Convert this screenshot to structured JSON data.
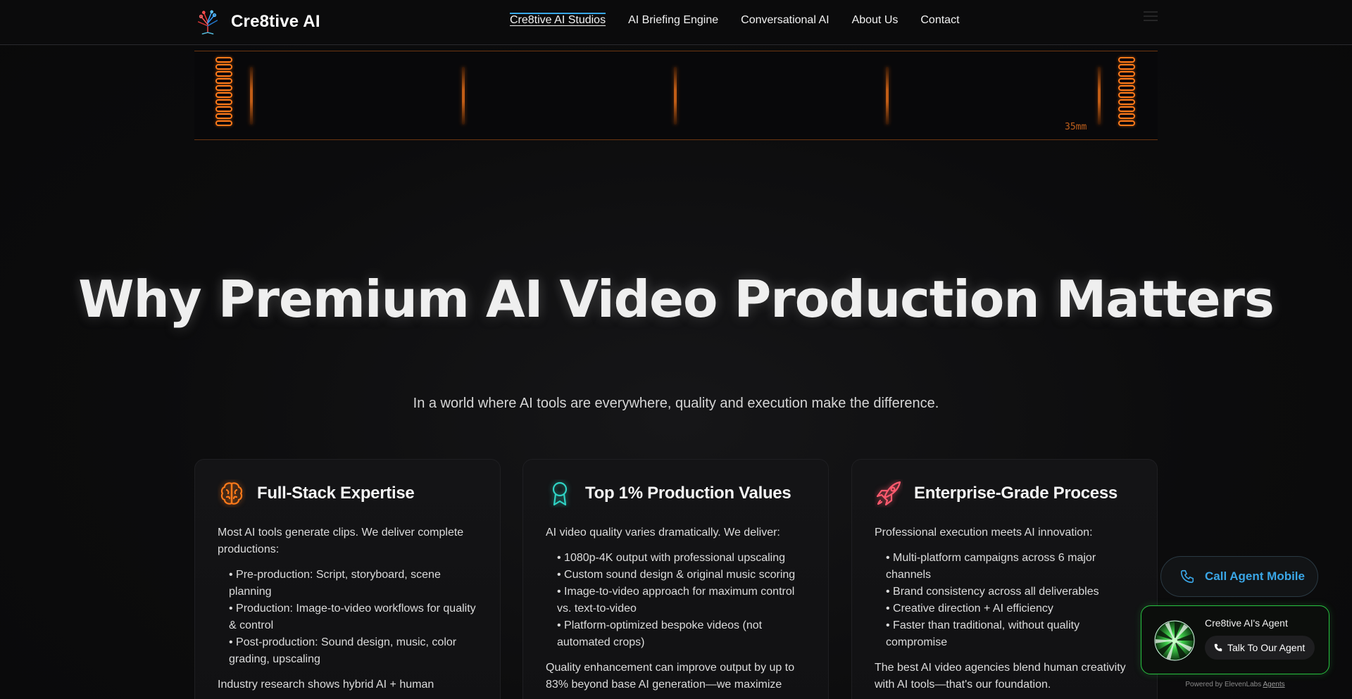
{
  "nav": {
    "brand": "Cre8tive AI",
    "brand_logo_icon": "tree-logo-icon",
    "links": [
      {
        "label": "Cre8tive AI Studios",
        "active": true
      },
      {
        "label": "AI Briefing Engine"
      },
      {
        "label": "Conversational AI"
      },
      {
        "label": "About Us"
      },
      {
        "label": "Contact"
      }
    ],
    "menu_icon": "hamburger-icon"
  },
  "film_strip": {
    "label": "35mm",
    "accent": "#ff7a1a"
  },
  "hero": {
    "title": "Why Premium AI Video Production Matters",
    "subtitle": "In a world where AI tools are everywhere, quality and execution make the difference."
  },
  "cards": [
    {
      "icon": "brain-icon",
      "icon_color": "#ff7a1a",
      "title": "Full-Stack Expertise",
      "intro": "Most AI tools generate clips. We deliver complete productions:",
      "items": [
        "Pre-production: Script, storyboard, scene planning",
        "Production: Image-to-video workflows for quality & control",
        "Post-production: Sound design, music, color grading, upscaling"
      ],
      "outro": "Industry research shows hybrid AI + human"
    },
    {
      "icon": "award-ribbon-icon",
      "icon_color": "#2fd3c4",
      "title": "Top 1% Production Values",
      "intro": "AI video quality varies dramatically. We deliver:",
      "items": [
        "1080p-4K output with professional upscaling",
        "Custom sound design & original music scoring",
        "Image-to-video approach for maximum control vs. text-to-video",
        "Platform-optimized bespoke videos (not automated crops)"
      ],
      "outro": "Quality enhancement can improve output by up to 83% beyond base AI generation—we maximize"
    },
    {
      "icon": "rocket-icon",
      "icon_color": "#ff5a6e",
      "title": "Enterprise-Grade Process",
      "intro": "Professional execution meets AI innovation:",
      "items": [
        "Multi-platform campaigns across 6 major channels",
        "Brand consistency across all deliverables",
        "Creative direction + AI efficiency",
        "Faster than traditional, without quality compromise"
      ],
      "outro": "The best AI video agencies blend human creativity with AI tools—that's our foundation."
    }
  ],
  "call_button": {
    "label": "Call Agent Mobile",
    "icon": "phone-icon",
    "color": "#3aa6e6"
  },
  "agent_widget": {
    "name": "Cre8tive AI's Agent",
    "button_label": "Talk To Our Agent",
    "button_icon": "phone-icon",
    "border_color": "#27c140",
    "powered_prefix": "Powered by ElevenLabs",
    "powered_link": "Agents"
  }
}
